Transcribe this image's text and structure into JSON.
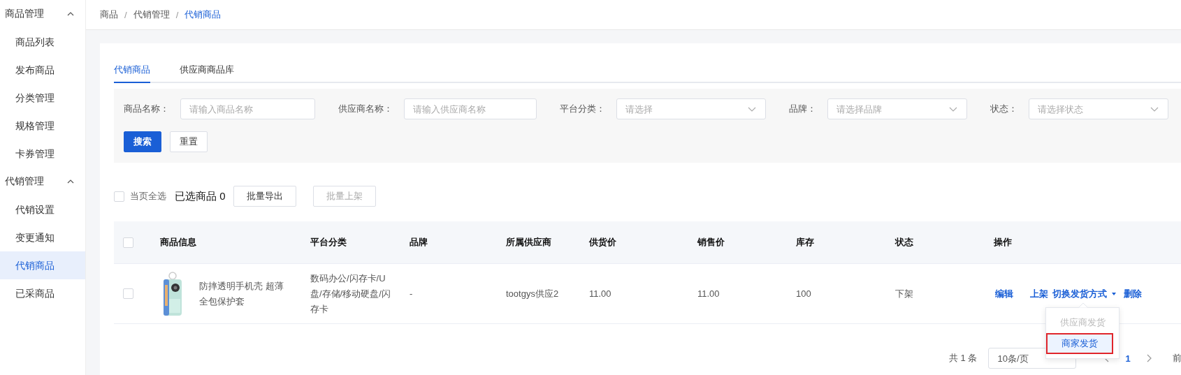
{
  "sidebar": {
    "groups": [
      {
        "label": "商品管理",
        "expanded": true,
        "items": [
          {
            "label": "商品列表",
            "selected": false
          },
          {
            "label": "发布商品",
            "selected": false
          },
          {
            "label": "分类管理",
            "selected": false
          },
          {
            "label": "规格管理",
            "selected": false
          },
          {
            "label": "卡券管理",
            "selected": false
          }
        ]
      },
      {
        "label": "代销管理",
        "expanded": true,
        "items": [
          {
            "label": "代销设置",
            "selected": false
          },
          {
            "label": "变更通知",
            "selected": false
          },
          {
            "label": "代销商品",
            "selected": true
          },
          {
            "label": "已采商品",
            "selected": false
          }
        ]
      }
    ]
  },
  "breadcrumb": {
    "separator": "/",
    "items": [
      "商品",
      "代销管理",
      "代销商品"
    ]
  },
  "tabs": [
    {
      "label": "代销商品",
      "selected": true
    },
    {
      "label": "供应商商品库",
      "selected": false
    }
  ],
  "filters": [
    {
      "label": "商品名称：",
      "kind": "input",
      "placeholder": "请输入商品名称"
    },
    {
      "label": "供应商名称：",
      "kind": "input",
      "placeholder": "请输入供应商名称"
    },
    {
      "label": "平台分类：",
      "kind": "select",
      "placeholder": "请选择"
    },
    {
      "label": "品牌：",
      "kind": "select",
      "placeholder": "请选择品牌"
    },
    {
      "label": "状态：",
      "kind": "select",
      "placeholder": "请选择状态"
    }
  ],
  "filter_buttons": [
    {
      "label": "搜索",
      "kind": "primary"
    },
    {
      "label": "重置",
      "kind": "default"
    }
  ],
  "batch": {
    "select_all": {
      "label": "当页全选",
      "checked": false
    },
    "selected_count": "已选商品 0",
    "buttons": [
      {
        "label": "批量导出",
        "disabled": false
      },
      {
        "label": "批量上架",
        "disabled": true
      }
    ]
  },
  "table": {
    "header_checked": false,
    "columns": [
      "商品信息",
      "平台分类",
      "品牌",
      "所属供应商",
      "供货价",
      "销售价",
      "库存",
      "状态",
      "操作"
    ],
    "rows": [
      {
        "checked": false,
        "product": {
          "kind": "picture",
          "name": "防摔透明手机壳 超薄全包保护套"
        },
        "category": "数码办公/闪存卡/U盘/存储/移动硬盘/闪存卡",
        "brand": "-",
        "supplier": "tootgys供应2",
        "supply_price": "11.00",
        "sale_price": "11.00",
        "stock": "100",
        "status": "下架",
        "actions": [
          {
            "label": "编辑",
            "kind": "link"
          },
          {
            "label": "上架",
            "kind": "link"
          },
          {
            "label": "切换发货方式",
            "kind": "dropdown",
            "expanded": true,
            "options": [
              {
                "label": "供应商发货",
                "disabled": true,
                "selected": false
              },
              {
                "label": "商家发货",
                "disabled": false,
                "selected": true
              }
            ]
          },
          {
            "label": "删除",
            "kind": "link"
          }
        ]
      }
    ]
  },
  "pagination": {
    "total": "共 1 条",
    "page_size": "10条/页",
    "pages": [
      {
        "label": "1",
        "selected": true
      }
    ],
    "jump_label": "前"
  }
}
